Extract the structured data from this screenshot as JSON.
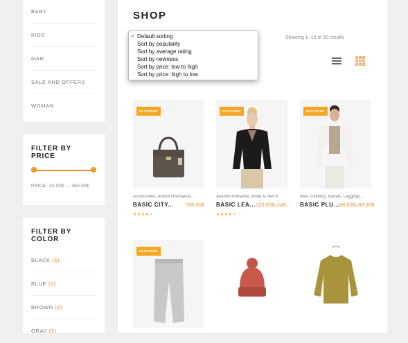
{
  "sidebar": {
    "categories": [
      "BABY",
      "KIDS",
      "MAN",
      "SALE AND OFFERS",
      "WOMAN"
    ],
    "price_filter": {
      "title": "FILTER BY PRICE",
      "range_text": "PRICE: 10.00$ — 360.00$"
    },
    "color_filter": {
      "title": "FILTER BY COLOR",
      "items": [
        {
          "label": "BLACK",
          "count": "(5)"
        },
        {
          "label": "BLUE",
          "count": "(5)"
        },
        {
          "label": "BROWN",
          "count": "(8)"
        },
        {
          "label": "GRAY",
          "count": "(5)"
        }
      ]
    }
  },
  "main": {
    "title": "SHOP",
    "showing": "Showing 1–10 of 30 results",
    "sort_options": [
      {
        "label": "Default sorting",
        "checked": true
      },
      {
        "label": "Sort by popularity",
        "checked": false
      },
      {
        "label": "Sort by average rating",
        "checked": false
      },
      {
        "label": "Sort by newness",
        "checked": false
      },
      {
        "label": "Sort by price: low to high",
        "checked": false
      },
      {
        "label": "Sort by price: high to low",
        "checked": false
      }
    ],
    "view_icons": [
      "list-view-icon",
      "grid-view-icon"
    ]
  },
  "products": [
    {
      "badge": "FEATURED",
      "categories": "Accessories, Autumn Romance, ...",
      "name": "BASIC CITY...",
      "price": "156.00$",
      "rating": 4
    },
    {
      "badge": "FEATURED",
      "categories": "Autumn Romance, Bride & Hen P...",
      "name": "BASIC LEA...",
      "price": "120.00$–145...",
      "rating": 4
    },
    {
      "badge": "FEATURED",
      "categories": "Man, Clothing, Brands, Leggings...",
      "name": "BASIC PLU...",
      "price": "66.00$–69.00$",
      "rating": 0
    },
    {
      "badge": "FEATURED",
      "categories": "",
      "name": "",
      "price": "",
      "rating": 0
    },
    {
      "badge": "",
      "categories": "",
      "name": "",
      "price": "",
      "rating": 0
    },
    {
      "badge": "",
      "categories": "",
      "name": "",
      "price": "",
      "rating": 0
    }
  ],
  "colors": {
    "accent": "#f08a24",
    "badge": "#f5a623"
  },
  "check_mark": "✓",
  "stars": {
    "on": "★★★★",
    "off": "★"
  }
}
